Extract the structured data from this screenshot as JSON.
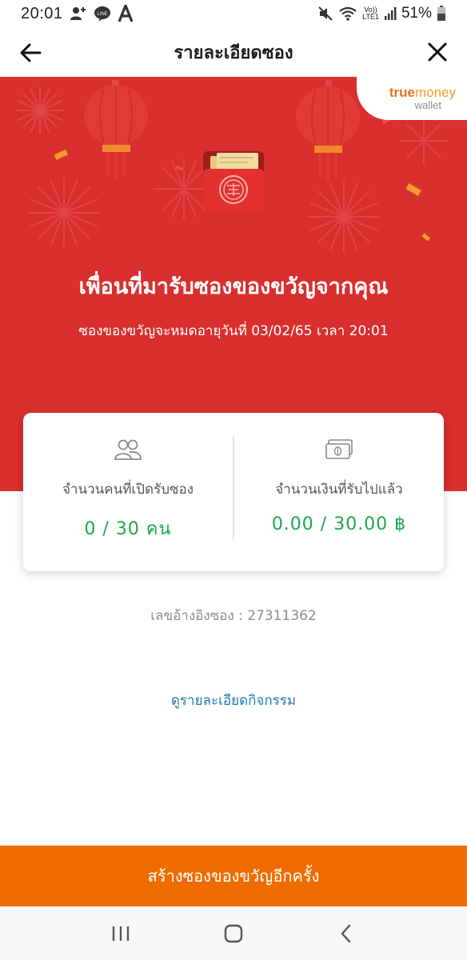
{
  "status_bar": {
    "time": "20:01",
    "battery": "51%",
    "icons": [
      "add-contact-icon",
      "line-app-icon",
      "a-app-icon",
      "mute-icon",
      "wifi-icon",
      "volte-icon",
      "signal-icon",
      "battery-icon"
    ],
    "volte_text": "Vo))",
    "lte_text": "LTE1"
  },
  "header": {
    "title": "รายละเอียดซอง",
    "back_icon": "arrow-left-icon",
    "close_icon": "close-icon"
  },
  "banner": {
    "background_color": "#d9302f",
    "brand_true": "true",
    "brand_money": "money",
    "brand_wallet": "wallet",
    "title": "เพื่อนที่มารับซองของขวัญจากคุณ",
    "subtitle": "ซองของขวัญจะหมดอายุวันที่ 03/02/65 เวลา 20:01"
  },
  "stats": {
    "people": {
      "icon": "people-icon",
      "label": "จำนวนคนที่เปิดรับซอง",
      "value": "0 / 30 คน"
    },
    "money": {
      "icon": "banknote-icon",
      "label": "จำนวนเงินที่รับไปแล้ว",
      "value": "0.00 / 30.00 ฿"
    },
    "value_color": "#1ba84a"
  },
  "reference": {
    "label": "เลขอ้างอิงซอง :",
    "number": "27311362"
  },
  "activity_link": "ดูรายละเอียดกิจกรรม",
  "bottom_button": {
    "label": "สร้างซองของขวัญอีกครั้ง",
    "color": "#ee6c00"
  },
  "nav_bar": {
    "icons": [
      "recent-apps-icon",
      "home-icon",
      "back-icon"
    ]
  }
}
